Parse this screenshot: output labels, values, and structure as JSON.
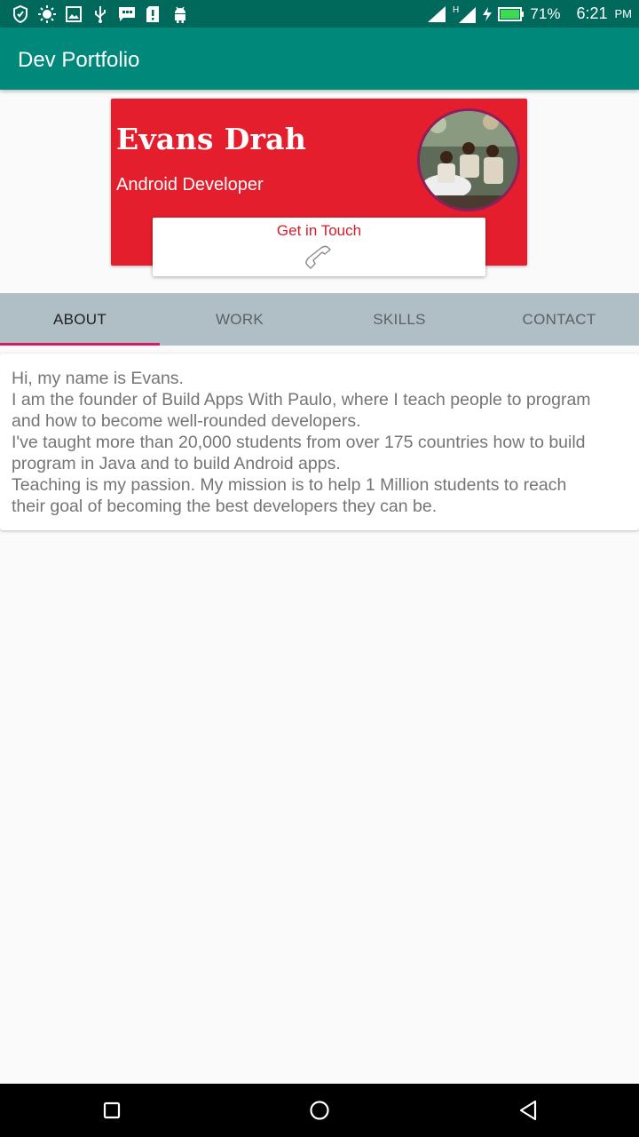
{
  "status_bar": {
    "battery": "71%",
    "time": "6:21",
    "ampm": "PM",
    "icons": [
      "shield-icon",
      "brightness-icon",
      "image-icon",
      "usb-icon",
      "message-icon",
      "alert-icon",
      "android-icon",
      "signal-icon",
      "network-h-icon",
      "charging-icon",
      "battery-icon"
    ]
  },
  "appbar": {
    "title": "Dev Portfolio"
  },
  "profile": {
    "name": "Evans Drah",
    "role": "Android Developer",
    "touch_label": "Get in Touch",
    "touch_icon": "phone-icon",
    "colors": {
      "card": "#e41e2c",
      "accent": "#d81b60"
    }
  },
  "tabs": [
    {
      "label": "ABOUT",
      "active": true
    },
    {
      "label": "WORK",
      "active": false
    },
    {
      "label": "SKILLS",
      "active": false
    },
    {
      "label": "CONTACT",
      "active": false
    }
  ],
  "about": {
    "lines": [
      "Hi, my name is Evans.",
      "I am the founder of Build Apps With Paulo, where I teach people to program",
      "and how to become well-rounded developers.",
      "I've taught more than 20,000 students from over 175 countries how to build",
      "program in Java and to build Android apps.",
      "Teaching is my passion.  My mission is to help 1 Million students to reach",
      "their goal of becoming the best developers they can be."
    ]
  },
  "navbar": {
    "icons": [
      "recents-icon",
      "home-icon",
      "back-icon"
    ]
  }
}
